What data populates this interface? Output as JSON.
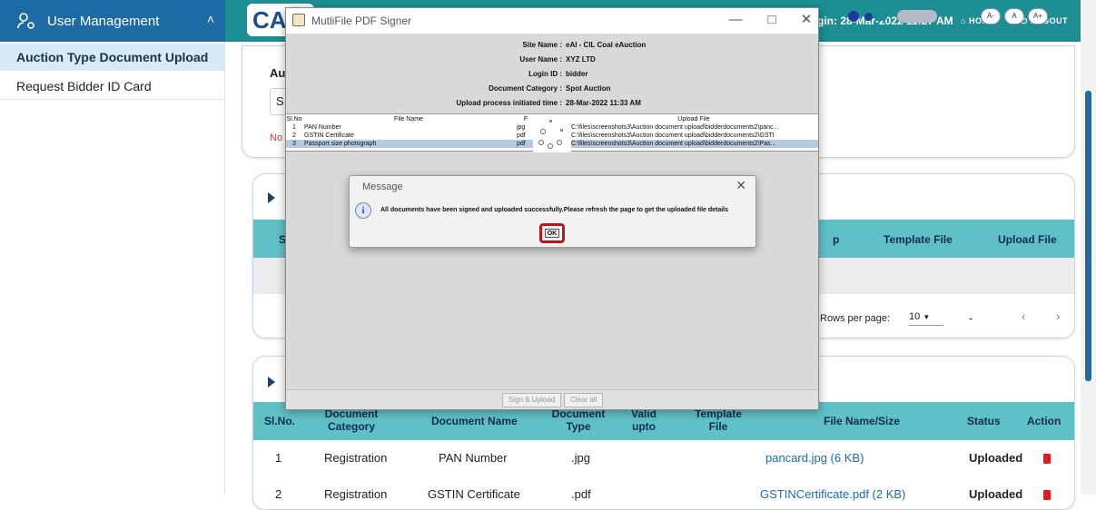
{
  "sidebar": {
    "header": "User Management",
    "items": [
      {
        "label": "Auction Type Document Upload"
      },
      {
        "label": "Request Bidder ID Card"
      }
    ]
  },
  "topbar": {
    "logo_text": "CA",
    "login_info": "gin: 28-Mar-2022 11:27 AM",
    "home": "HOME",
    "logout": "LOGOUT",
    "font_buttons": [
      "A-",
      "A",
      "A+"
    ],
    "theme_dot_color": "#1f3a9a",
    "brand_color": "#1d8f94"
  },
  "background": {
    "upload_form": {
      "label_fragment": "Au",
      "select_fragment": "S",
      "note_fragment": "No"
    },
    "template_table": {
      "col_sl": "Sl",
      "col_p": "p",
      "col_template": "Template File",
      "col_upload": "Upload File",
      "rows_per_page_label": "Rows per page:",
      "rows_per_page_value": "10",
      "range": "-"
    },
    "doc_table": {
      "headers": [
        "Sl.No.",
        "Document Category",
        "Document Name",
        "Document Type",
        "Valid upto",
        "Template File",
        "File Name/Size",
        "Status",
        "Action"
      ],
      "rows": [
        {
          "sl": "1",
          "category": "Registration",
          "name": "PAN Number",
          "type": ".jpg",
          "file": "pancard.jpg (6 KB)",
          "status": "Uploaded"
        },
        {
          "sl": "2",
          "category": "Registration",
          "name": "GSTIN Certificate",
          "type": ".pdf",
          "file": "GSTINCertificate.pdf (2 KB)",
          "status": "Uploaded"
        }
      ]
    }
  },
  "window": {
    "title": "MutliFile PDF Signer",
    "site_name_label": "Site Name :",
    "site_name": "eAI - CIL Coal eAuction",
    "user_name_label": "User Name :",
    "user_name": "XYZ LTD",
    "login_id_label": "Login ID :",
    "login_id": "bidder",
    "doc_cat_label": "Document Category :",
    "doc_cat": "Spot Auction",
    "upload_time_label": "Upload process initiated time :",
    "upload_time": "28-Mar-2022 11:33 AM",
    "file_table": {
      "headers": [
        "Sl.No",
        "File Name",
        "F",
        "Upload File"
      ],
      "rows": [
        {
          "sl": "1",
          "name": "PAN Number",
          "f": "jpg",
          "path": "C:\\files\\screenshots3\\Auction document upload\\bidderdocuments2\\panc..."
        },
        {
          "sl": "2",
          "name": "GSTIN Certificate",
          "f": "pdf",
          "path": "C:\\files\\screenshots3\\Auction document upload\\bidderdocuments2\\GSTI"
        },
        {
          "sl": "3",
          "name": "Passport size photograph",
          "f": "pdf",
          "path": "C:\\files\\screenshots3\\Auction document upload\\bidderdocuments2\\Pas..."
        }
      ]
    },
    "sign_upload": "Sign & Upload",
    "clear_all": "Clear all"
  },
  "message": {
    "title": "Message",
    "text": "All documents have been signed and uploaded successfully.Please refresh the page to get the uploaded file details",
    "ok": "OK"
  }
}
